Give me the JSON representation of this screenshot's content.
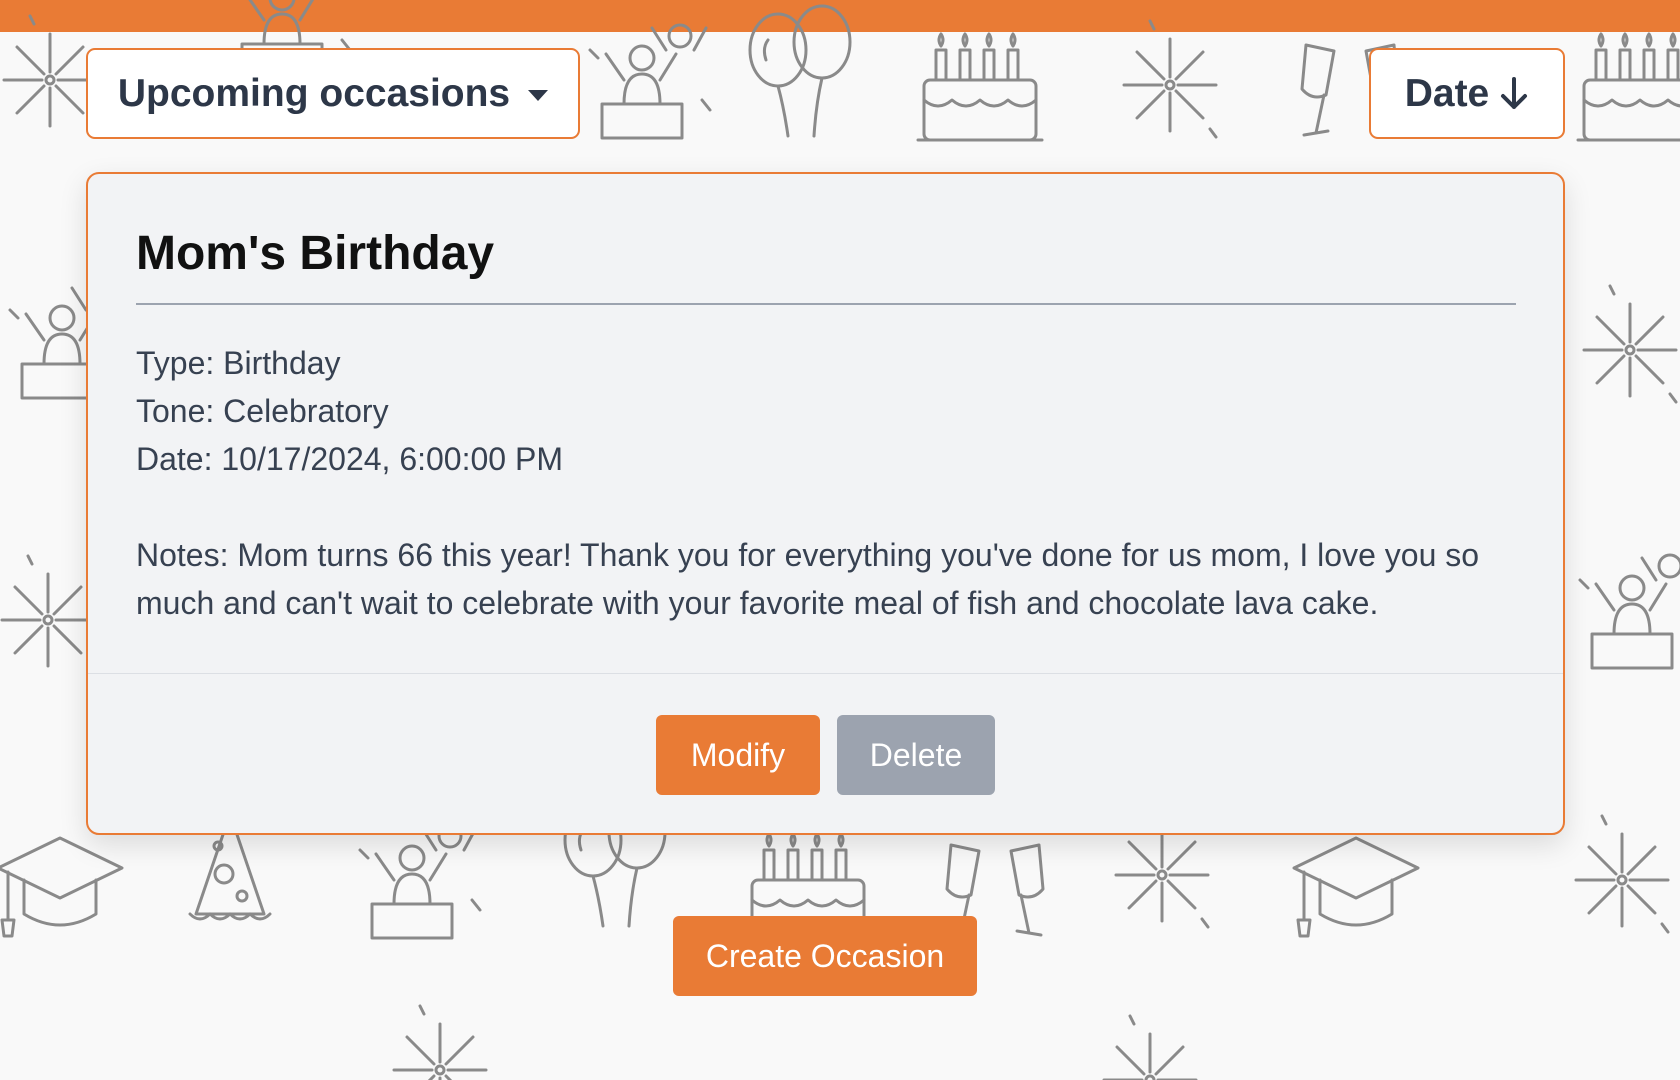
{
  "colors": {
    "accent": "#e97b35",
    "secondary_button": "#9ca3af",
    "card_bg": "#f2f3f5"
  },
  "background": {
    "pattern_icons": [
      "fireworks-icon",
      "party-people-icon",
      "balloons-icon",
      "birthday-cake-icon",
      "champagne-glasses-icon",
      "graduation-cap-icon",
      "party-hat-icon",
      "sparkle-icon"
    ]
  },
  "filter": {
    "label": "Upcoming occasions",
    "icon": "caret-down-icon"
  },
  "sort": {
    "label": "Date",
    "icon": "arrow-down-icon"
  },
  "occasion": {
    "title": "Mom's Birthday",
    "type": "Type: Birthday",
    "tone": "Tone: Celebratory",
    "date": "Date: 10/17/2024, 6:00:00 PM",
    "notes": "Notes: Mom turns 66 this year! Thank you for everything you've done for us mom, I love you so much and can't wait to celebrate with your favorite meal of fish and chocolate lava cake.",
    "modify_label": "Modify",
    "delete_label": "Delete"
  },
  "create_label": "Create Occasion"
}
